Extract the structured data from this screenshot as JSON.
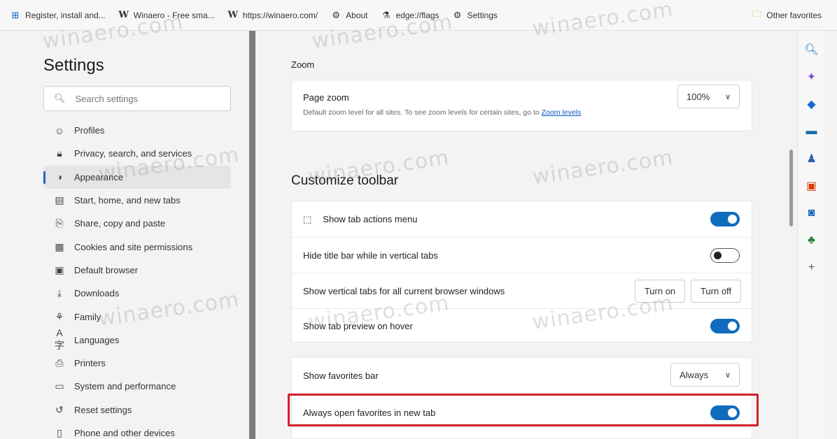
{
  "favorites_bar": {
    "items": [
      {
        "label": "Register, install and...",
        "icon": "windows-logo-icon"
      },
      {
        "label": "Winaero - Free sma...",
        "icon": "winaero-w-icon"
      },
      {
        "label": "https://winaero.com/",
        "icon": "winaero-w-icon"
      },
      {
        "label": "About",
        "icon": "gear-icon"
      },
      {
        "label": "edge://flags",
        "icon": "flask-icon"
      },
      {
        "label": "Settings",
        "icon": "gear-icon"
      }
    ],
    "other_favorites": "Other favorites"
  },
  "sidebar": {
    "title": "Settings",
    "search_placeholder": "Search settings",
    "items": [
      {
        "label": "Profiles",
        "icon": "profile-icon"
      },
      {
        "label": "Privacy, search, and services",
        "icon": "lock-icon"
      },
      {
        "label": "Appearance",
        "icon": "appearance-icon",
        "active": true
      },
      {
        "label": "Start, home, and new tabs",
        "icon": "home-icon"
      },
      {
        "label": "Share, copy and paste",
        "icon": "share-icon"
      },
      {
        "label": "Cookies and site permissions",
        "icon": "cookie-icon"
      },
      {
        "label": "Default browser",
        "icon": "browser-icon"
      },
      {
        "label": "Downloads",
        "icon": "download-icon"
      },
      {
        "label": "Family",
        "icon": "family-icon"
      },
      {
        "label": "Languages",
        "icon": "language-icon"
      },
      {
        "label": "Printers",
        "icon": "printer-icon"
      },
      {
        "label": "System and performance",
        "icon": "system-icon"
      },
      {
        "label": "Reset settings",
        "icon": "reset-icon"
      },
      {
        "label": "Phone and other devices",
        "icon": "phone-icon"
      }
    ]
  },
  "zoom": {
    "section_label": "Zoom",
    "page_zoom_title": "Page zoom",
    "page_zoom_desc": "Default zoom level for all sites. To see zoom levels for certain sites, go to",
    "zoom_link": "Zoom levels",
    "zoom_value": "100%"
  },
  "toolbar": {
    "heading": "Customize toolbar",
    "show_tab_actions": {
      "label": "Show tab actions menu",
      "on": true
    },
    "hide_title_bar": {
      "label": "Hide title bar while in vertical tabs",
      "on": false
    },
    "vertical_tabs": {
      "label": "Show vertical tabs for all current browser windows",
      "turn_on": "Turn on",
      "turn_off": "Turn off"
    },
    "tab_preview": {
      "label": "Show tab preview on hover",
      "on": true
    }
  },
  "favorites": {
    "show_bar": {
      "label": "Show favorites bar",
      "value": "Always"
    },
    "open_new_tab": {
      "label": "Always open favorites in new tab",
      "on": true
    }
  },
  "watermark_text": "winaero.com",
  "colors": {
    "accent": "#0f6cbd",
    "highlight": "#d0202a"
  }
}
